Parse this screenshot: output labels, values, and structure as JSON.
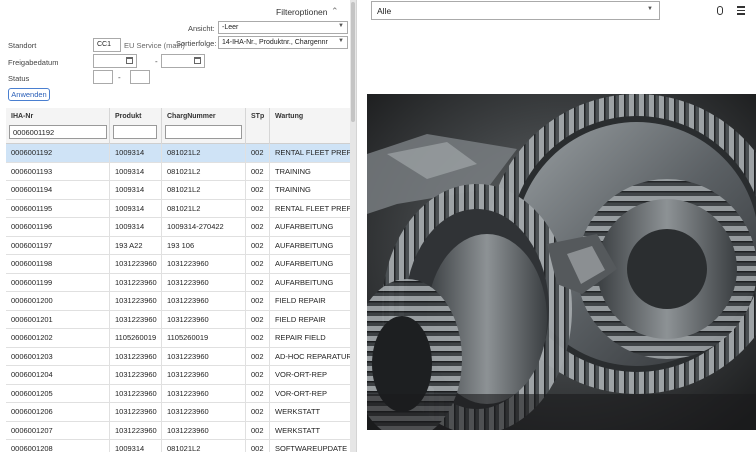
{
  "filter": {
    "title": "Filteroptionen",
    "ansicht_label": "Ansicht:",
    "ansicht_value": "-Leer",
    "sort_label": "Sortierfolge:",
    "sort_value": "14-IHA-Nr., Produktnr., Chargennr",
    "standort_label": "Standort",
    "standort_code": "CC1",
    "standort_text": "EU Service (main)",
    "freigabe_label": "Freigabedatum",
    "status_label": "Status",
    "range_sep": "-",
    "apply_label": "Anwenden"
  },
  "table": {
    "columns": [
      "IHA-Nr",
      "Produkt",
      "ChargNummer",
      "STp",
      "Wartung"
    ],
    "filter_values": [
      "0006001192",
      "",
      "",
      "",
      ""
    ],
    "rows": [
      [
        "0006001192",
        "1009314",
        "081021L2",
        "002",
        "RENTAL FLEET PREP"
      ],
      [
        "0006001193",
        "1009314",
        "081021L2",
        "002",
        "TRAINING"
      ],
      [
        "0006001194",
        "1009314",
        "081021L2",
        "002",
        "TRAINING"
      ],
      [
        "0006001195",
        "1009314",
        "081021L2",
        "002",
        "RENTAL FLEET PREP"
      ],
      [
        "0006001196",
        "1009314",
        "1009314-270422",
        "002",
        "AUFARBEITUNG"
      ],
      [
        "0006001197",
        "193 A22",
        "193 106",
        "002",
        "AUFARBEITUNG"
      ],
      [
        "0006001198",
        "1031223960",
        "1031223960",
        "002",
        "AUFARBEITUNG"
      ],
      [
        "0006001199",
        "1031223960",
        "1031223960",
        "002",
        "AUFARBEITUNG"
      ],
      [
        "0006001200",
        "1031223960",
        "1031223960",
        "002",
        "FIELD REPAIR"
      ],
      [
        "0006001201",
        "1031223960",
        "1031223960",
        "002",
        "FIELD REPAIR"
      ],
      [
        "0006001202",
        "1105260019",
        "1105260019",
        "002",
        "REPAIR FIELD"
      ],
      [
        "0006001203",
        "1031223960",
        "1031223960",
        "002",
        "AD-HOC REPARATUR"
      ],
      [
        "0006001204",
        "1031223960",
        "1031223960",
        "002",
        "VOR-ORT-REP"
      ],
      [
        "0006001205",
        "1031223960",
        "1031223960",
        "002",
        "VOR-ORT-REP"
      ],
      [
        "0006001206",
        "1031223960",
        "1031223960",
        "002",
        "WERKSTATT"
      ],
      [
        "0006001207",
        "1031223960",
        "1031223960",
        "002",
        "WERKSTATT"
      ],
      [
        "0006001208",
        "1009314",
        "081021L2",
        "002",
        "SOFTWAREUPDATE_E"
      ]
    ],
    "selected_row": 0
  },
  "right": {
    "dropdown_value": "Alle",
    "icons": [
      "paperclip-icon",
      "list-icon"
    ]
  }
}
